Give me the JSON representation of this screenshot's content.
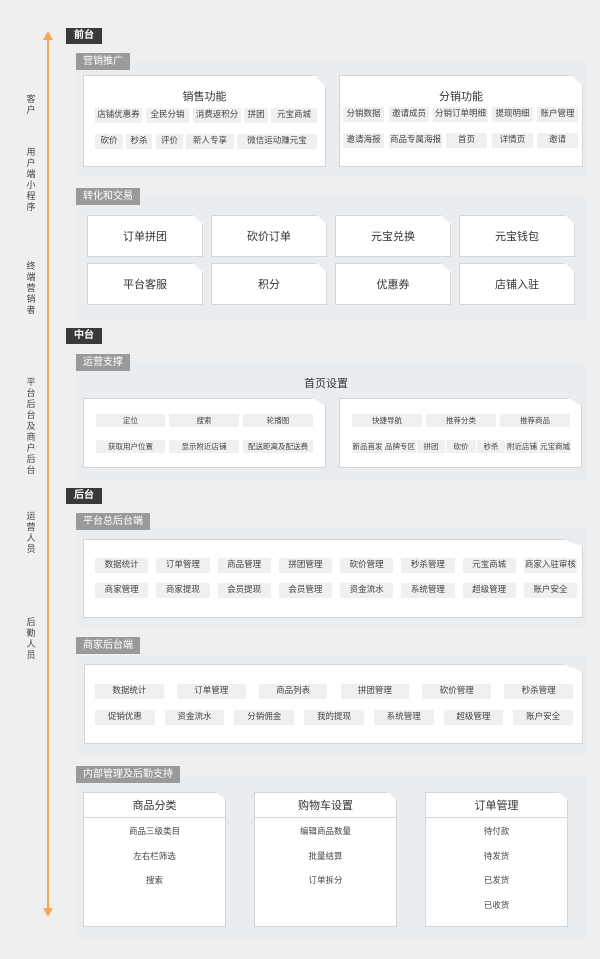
{
  "axis": {
    "color": "#f2a65a",
    "labels": [
      "客户",
      "用户端小程序",
      "终端营销者",
      "平台后台及商户后台",
      "运营人员",
      "后勤人员"
    ]
  },
  "tiers": {
    "front": "前台",
    "middle": "中台",
    "back": "后台"
  },
  "marketing": {
    "tag": "营销推广",
    "sales": {
      "title": "销售功能",
      "row1": [
        "店铺优惠券",
        "全民分销",
        "消费返积分",
        "拼团",
        "元宝商城"
      ],
      "row2": [
        "砍价",
        "秒杀",
        "评价",
        "新人专享",
        "微信运动赚元宝"
      ]
    },
    "distribution": {
      "title": "分销功能",
      "row1": [
        "分销数据",
        "邀请成员",
        "分销订单明细",
        "提现明细",
        "账户管理"
      ],
      "row2": [
        "邀请海报",
        "商品专属海报",
        "首页",
        "详情页",
        "邀请"
      ]
    }
  },
  "conversion": {
    "tag": "转化和交易",
    "items": [
      "订单拼团",
      "砍价订单",
      "元宝兑换",
      "元宝钱包",
      "平台客服",
      "积分",
      "优惠券",
      "店铺入驻"
    ]
  },
  "operations": {
    "tag": "运营支撑",
    "title": "首页设置",
    "left": {
      "row1": [
        "定位",
        "搜索",
        "轮播图"
      ],
      "row2": [
        "获取用户位置",
        "显示附近店铺",
        "配送距离及配送费"
      ]
    },
    "right": {
      "row1": [
        "快捷导航",
        "推荐分类",
        "推荐商品"
      ],
      "row2": [
        "新品首发",
        "品牌专区",
        "拼团",
        "砍价",
        "秒杀",
        "附近店铺",
        "元宝商城"
      ]
    }
  },
  "platform_admin": {
    "tag": "平台总后台端",
    "row1": [
      "数据统计",
      "订单管理",
      "商品管理",
      "拼团管理",
      "砍价管理",
      "秒杀管理",
      "元宝商城",
      "商家入驻审核"
    ],
    "row2": [
      "商家管理",
      "商家提现",
      "会员提现",
      "会员管理",
      "资金流水",
      "系统管理",
      "超级管理",
      "账户安全"
    ]
  },
  "merchant_admin": {
    "tag": "商家后台端",
    "row1": [
      "数据统计",
      "订单管理",
      "商品列表",
      "拼团管理",
      "砍价管理",
      "秒杀管理"
    ],
    "row2": [
      "促销优惠",
      "资金流水",
      "分销佣金",
      "我的提现",
      "系统管理",
      "超级管理",
      "账户安全"
    ]
  },
  "internal": {
    "tag": "内部管理及后勤支持",
    "cards": [
      {
        "title": "商品分类",
        "items": [
          "商品三级类目",
          "左右栏筛选",
          "搜索"
        ]
      },
      {
        "title": "购物车设置",
        "items": [
          "编辑商品数量",
          "批量结算",
          "订单拆分"
        ]
      },
      {
        "title": "订单管理",
        "items": [
          "待付款",
          "待发货",
          "已发货",
          "已收货"
        ]
      }
    ]
  }
}
